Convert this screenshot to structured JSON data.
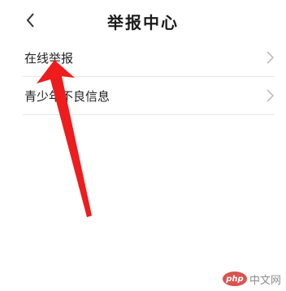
{
  "header": {
    "title": "举报中心",
    "back_icon": "chevron-left-icon"
  },
  "menu": {
    "items": [
      {
        "label": "在线举报",
        "icon": "chevron-right-icon"
      },
      {
        "label": "青少年不良信息",
        "icon": "chevron-right-icon"
      }
    ]
  },
  "annotation": {
    "color": "#ee1c1c"
  },
  "watermark": {
    "logo_text": "php",
    "text": "中文网"
  }
}
